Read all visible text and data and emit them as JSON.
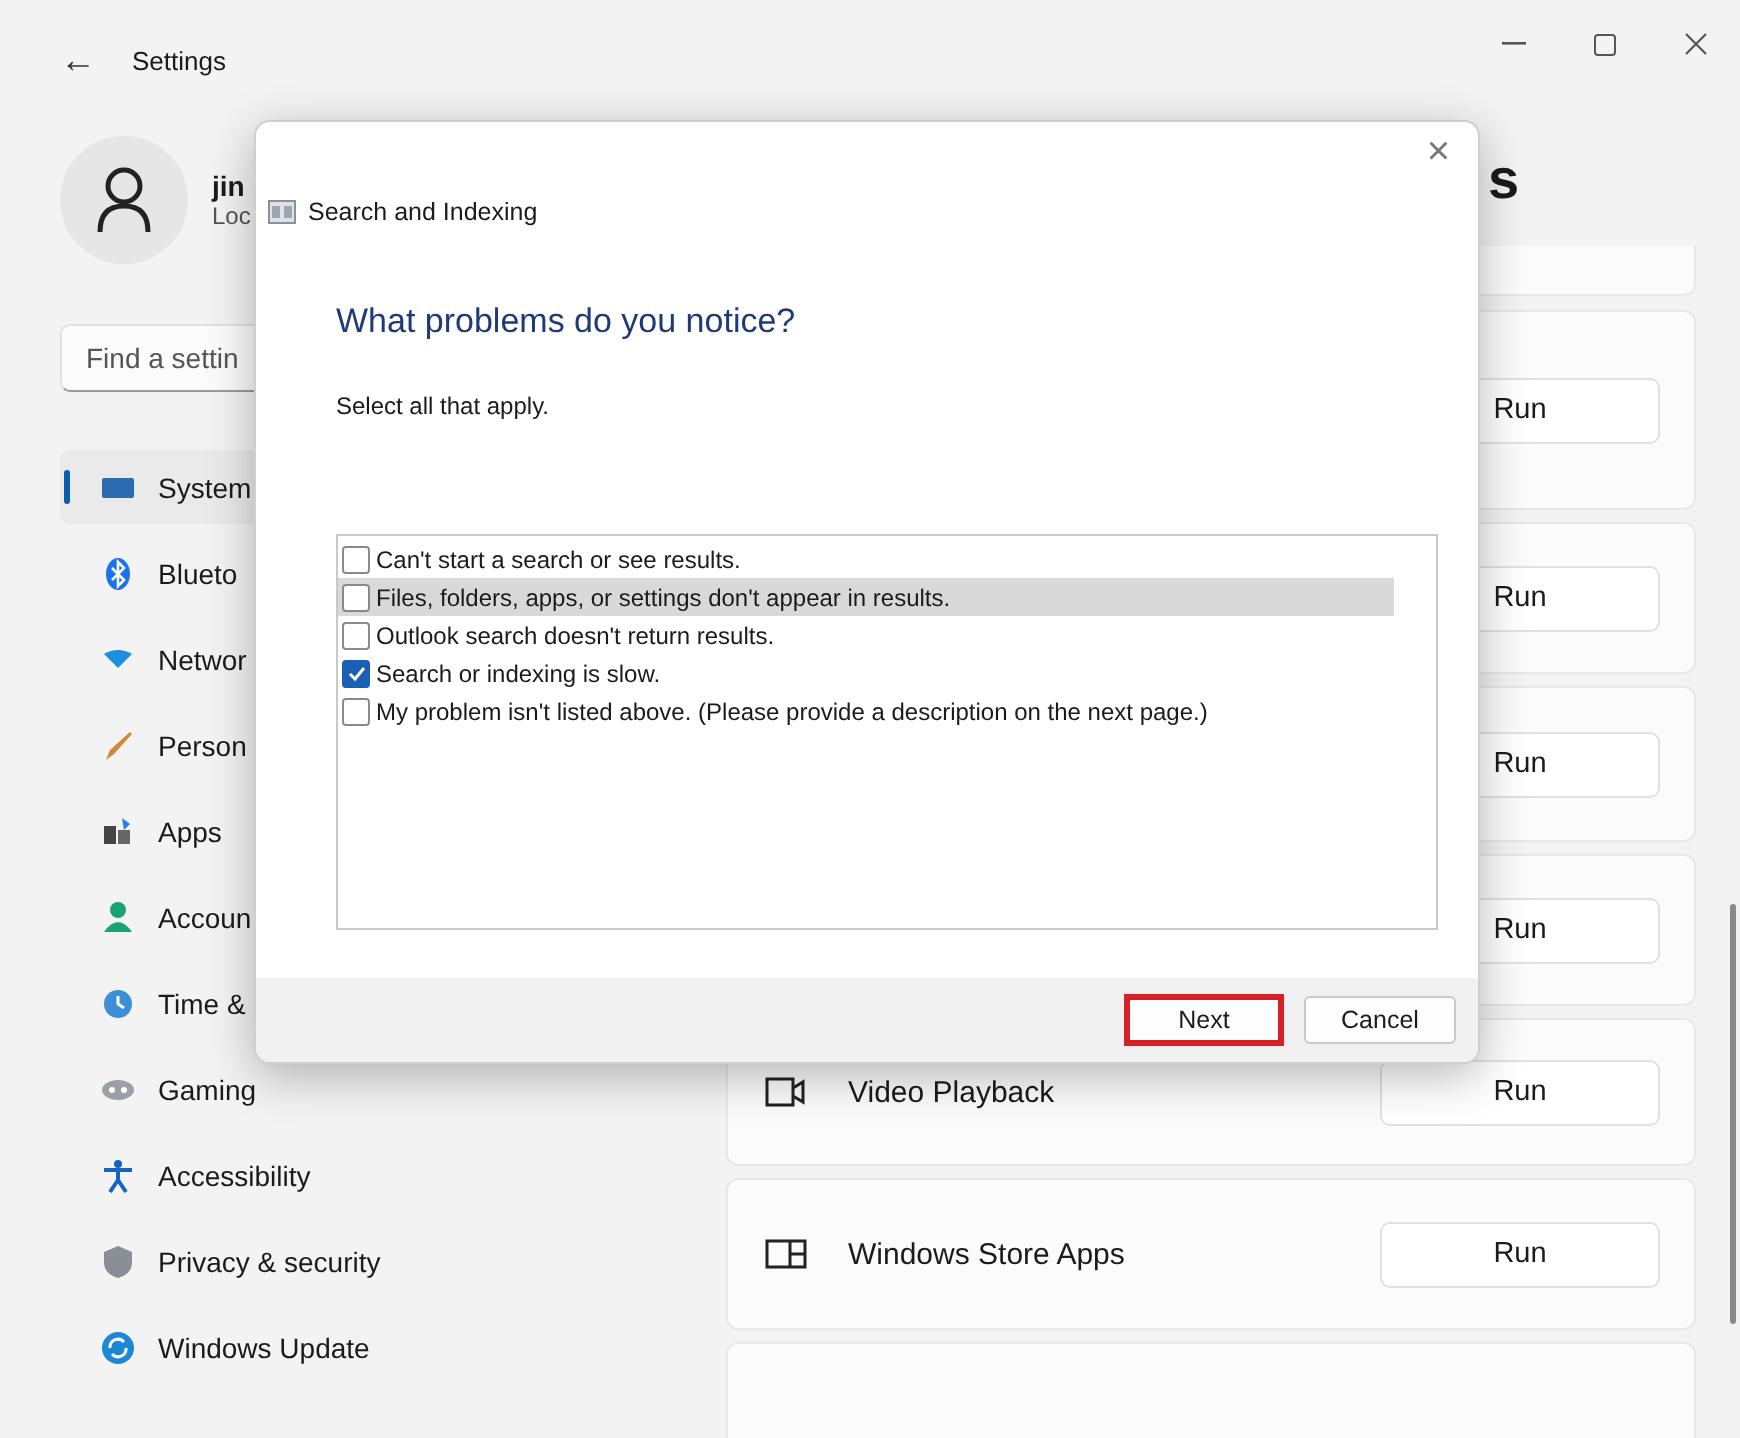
{
  "window": {
    "title": "Settings",
    "back": "←"
  },
  "profile": {
    "name": "jin",
    "subtitle": "Loc"
  },
  "search": {
    "placeholder": "Find a settin"
  },
  "sidebar": {
    "items": [
      {
        "label": "System",
        "selected": true
      },
      {
        "label": "Blueto",
        "selected": false
      },
      {
        "label": "Networ",
        "selected": false
      },
      {
        "label": "Person",
        "selected": false
      },
      {
        "label": "Apps",
        "selected": false
      },
      {
        "label": "Accoun",
        "selected": false
      },
      {
        "label": "Time &",
        "selected": false
      },
      {
        "label": "Gaming",
        "selected": false
      },
      {
        "label": "Accessibility",
        "selected": false
      },
      {
        "label": "Privacy & security",
        "selected": false
      },
      {
        "label": "Windows Update",
        "selected": false
      }
    ]
  },
  "page": {
    "heading": "s"
  },
  "troubleshooters": [
    {
      "button": "Run"
    },
    {
      "button": "Run"
    },
    {
      "button": "Run"
    },
    {
      "button": "Run"
    },
    {
      "name": "Video Playback",
      "button": "Run"
    },
    {
      "name": "Windows Store Apps",
      "button": "Run"
    }
  ],
  "dialog": {
    "title": "Search and Indexing",
    "close": "×",
    "heading": "What problems do you notice?",
    "instruction": "Select all that apply.",
    "options": [
      {
        "label": "Can't start a search or see results.",
        "checked": false,
        "selected": false
      },
      {
        "label": "Files, folders, apps, or settings don't appear in results.",
        "checked": false,
        "selected": true
      },
      {
        "label": "Outlook search doesn't return results.",
        "checked": false,
        "selected": false
      },
      {
        "label": "Search or indexing is slow.",
        "checked": true,
        "selected": false
      },
      {
        "label": "My problem isn't listed above. (Please provide a description on the next page.)",
        "checked": false,
        "selected": false
      }
    ],
    "buttons": [
      {
        "label": "Next",
        "highlighted": true
      },
      {
        "label": "Cancel",
        "highlighted": false
      }
    ]
  }
}
